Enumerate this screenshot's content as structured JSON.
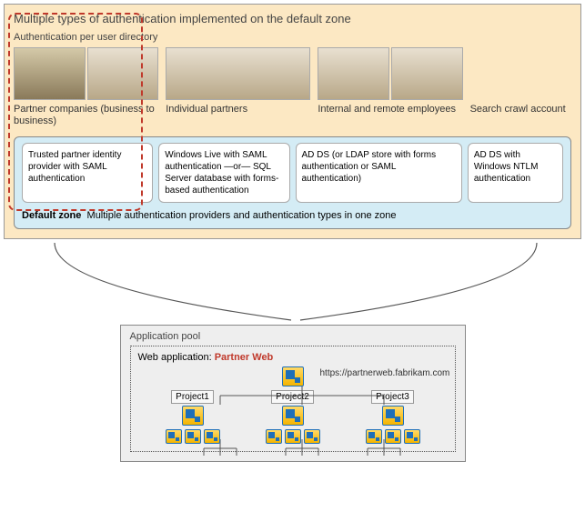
{
  "title": "Multiple types of authentication implemented on the default zone",
  "sub_title": "Authentication per user directory",
  "columns": [
    {
      "label": "Partner companies (business to business)",
      "auth": "Trusted partner identity provider with SAML authentication"
    },
    {
      "label": "Individual partners",
      "auth": "Windows Live with SAML authentication —or— SQL Server database with forms-based authentication"
    },
    {
      "label": "Internal and remote employees",
      "auth": "AD DS  (or LDAP store with forms authentication or SAML authentication)"
    },
    {
      "label": "Search crawl account",
      "auth": "AD DS with Windows NTLM authentication"
    }
  ],
  "default_zone": {
    "label_bold": "Default zone",
    "label_rest": "Multiple authentication providers and authentication types in one zone"
  },
  "app_pool": {
    "title": "Application pool",
    "webapp_prefix": "Web application:",
    "webapp_name": "Partner Web",
    "url": "https://partnerweb.fabrikam.com",
    "projects": [
      "Project1",
      "Project2",
      "Project3"
    ]
  }
}
